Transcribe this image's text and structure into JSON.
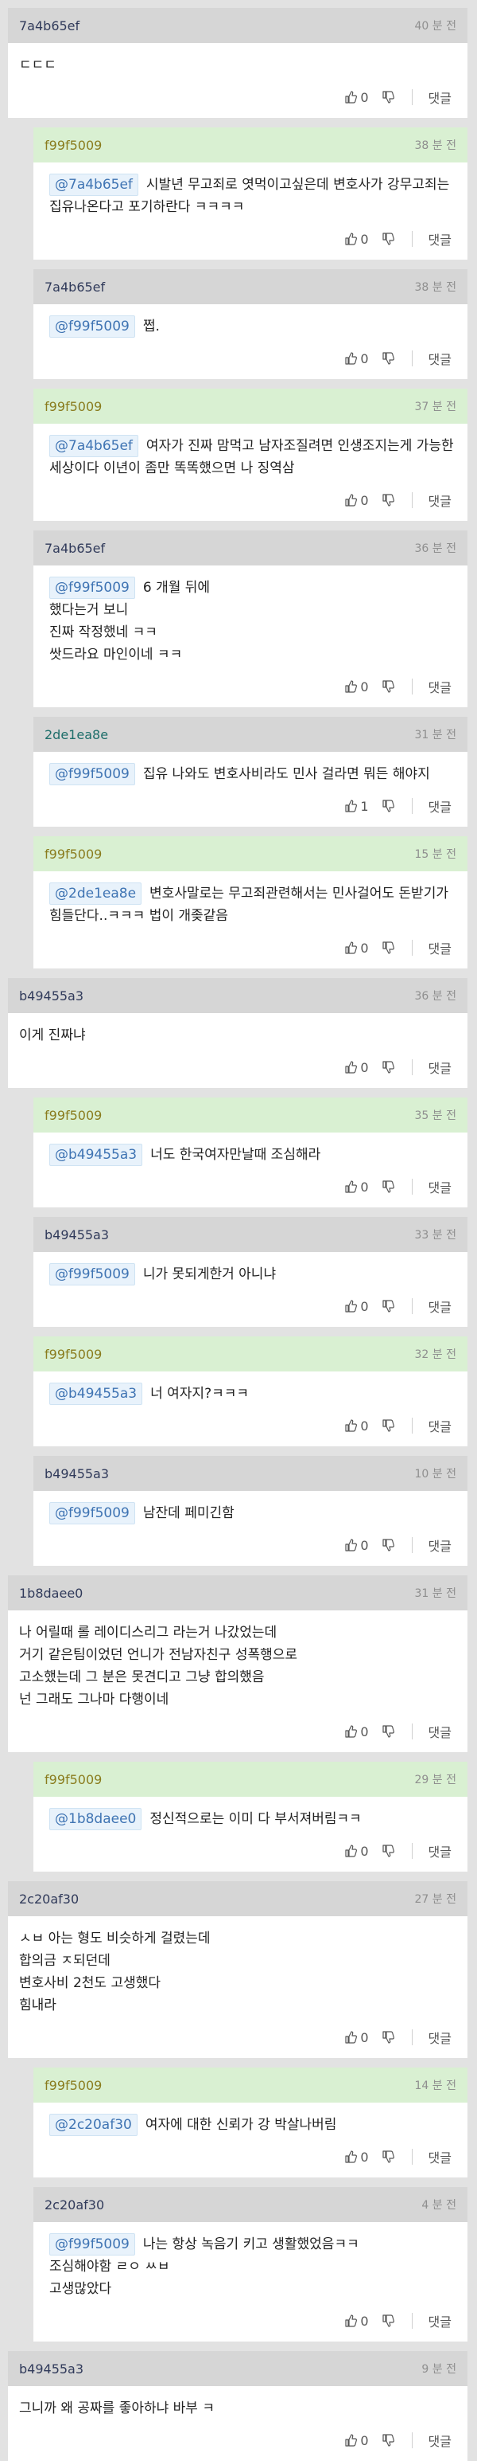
{
  "reply_label": "댓글",
  "comments": [
    {
      "author": "7a4b65ef",
      "time": "40 분 전",
      "mention": "",
      "text": "ㄷㄷㄷ",
      "likes": "0",
      "reply": false,
      "header": "gray",
      "color": "dark"
    },
    {
      "author": "f99f5009",
      "time": "38 분 전",
      "mention": "@7a4b65ef",
      "text": "시발년 무고죄로 엿먹이고싶은데 변호사가 강무고죄는 집유나온다고 포기하란다 ㅋㅋㅋㅋ",
      "likes": "0",
      "reply": true,
      "header": "green",
      "color": "olive"
    },
    {
      "author": "7a4b65ef",
      "time": "38 분 전",
      "mention": "@f99f5009",
      "text": "쩝.",
      "likes": "0",
      "reply": true,
      "header": "gray",
      "color": "dark"
    },
    {
      "author": "f99f5009",
      "time": "37 분 전",
      "mention": "@7a4b65ef",
      "text": "여자가 진짜 맘먹고 남자조질려면 인생조지는게 가능한세상이다 이년이 좀만 똑똑했으면 나 징역삼",
      "likes": "0",
      "reply": true,
      "header": "green",
      "color": "olive"
    },
    {
      "author": "7a4b65ef",
      "time": "36 분 전",
      "mention": "@f99f5009",
      "text": "6 개월 뒤에\n했다는거 보니\n진짜 작정했네 ㅋㅋ\n쌋드라요 마인이네 ㅋㅋ",
      "likes": "0",
      "reply": true,
      "header": "gray",
      "color": "dark"
    },
    {
      "author": "2de1ea8e",
      "time": "31 분 전",
      "mention": "@f99f5009",
      "text": "집유 나와도 변호사비라도 민사 걸라면 뭐든 해야지",
      "likes": "1",
      "reply": true,
      "header": "gray",
      "color": "teal"
    },
    {
      "author": "f99f5009",
      "time": "15 분 전",
      "mention": "@2de1ea8e",
      "text": "변호사말로는 무고죄관련해서는 민사걸어도 돈받기가 힘들단다..ㅋㅋㅋ 법이 개좆같음",
      "likes": "0",
      "reply": true,
      "header": "green",
      "color": "olive"
    },
    {
      "author": "b49455a3",
      "time": "36 분 전",
      "mention": "",
      "text": "이게 진짜냐",
      "likes": "0",
      "reply": false,
      "header": "gray",
      "color": "dark"
    },
    {
      "author": "f99f5009",
      "time": "35 분 전",
      "mention": "@b49455a3",
      "text": "너도 한국여자만날때 조심해라",
      "likes": "0",
      "reply": true,
      "header": "green",
      "color": "olive"
    },
    {
      "author": "b49455a3",
      "time": "33 분 전",
      "mention": "@f99f5009",
      "text": "니가 못되게한거 아니냐",
      "likes": "0",
      "reply": true,
      "header": "gray",
      "color": "dark"
    },
    {
      "author": "f99f5009",
      "time": "32 분 전",
      "mention": "@b49455a3",
      "text": "너 여자지?ㅋㅋㅋ",
      "likes": "0",
      "reply": true,
      "header": "green",
      "color": "olive"
    },
    {
      "author": "b49455a3",
      "time": "10 분 전",
      "mention": "@f99f5009",
      "text": "남잔데 페미긴함",
      "likes": "0",
      "reply": true,
      "header": "gray",
      "color": "dark"
    },
    {
      "author": "1b8daee0",
      "time": "31 분 전",
      "mention": "",
      "text": "나 어릴때 롤 레이디스리그 라는거 나갔었는데\n거기 같은팀이었던 언니가 전남자친구 성폭행으로\n고소했는데 그 분은 못견디고 그냥 합의했음\n넌 그래도 그나마 다행이네",
      "likes": "0",
      "reply": false,
      "header": "gray",
      "color": "dark"
    },
    {
      "author": "f99f5009",
      "time": "29 분 전",
      "mention": "@1b8daee0",
      "text": "정신적으로는 이미 다 부서져버림ㅋㅋ",
      "likes": "0",
      "reply": true,
      "header": "green",
      "color": "olive"
    },
    {
      "author": "2c20af30",
      "time": "27 분 전",
      "mention": "",
      "text": "ㅅㅂ 아는 형도 비슷하게 걸렸는데\n합의금 ㅈ되던데\n변호사비 2천도 고생했다\n힘내라",
      "likes": "0",
      "reply": false,
      "header": "gray",
      "color": "dark"
    },
    {
      "author": "f99f5009",
      "time": "14 분 전",
      "mention": "@2c20af30",
      "text": "여자에 대한 신뢰가 강 박살나버림",
      "likes": "0",
      "reply": true,
      "header": "green",
      "color": "olive"
    },
    {
      "author": "2c20af30",
      "time": "4 분 전",
      "mention": "@f99f5009",
      "text": "나는 항상 녹음기 키고 생활했었음ㅋㅋ\n조심해야함 ㄹㅇ ㅆㅂ\n고생많았다",
      "likes": "0",
      "reply": true,
      "header": "gray",
      "color": "dark"
    },
    {
      "author": "b49455a3",
      "time": "9 분 전",
      "mention": "",
      "text": "그니까 왜 공짜를 좋아하냐 바부 ㅋ",
      "likes": "0",
      "reply": false,
      "header": "gray",
      "color": "dark"
    }
  ]
}
